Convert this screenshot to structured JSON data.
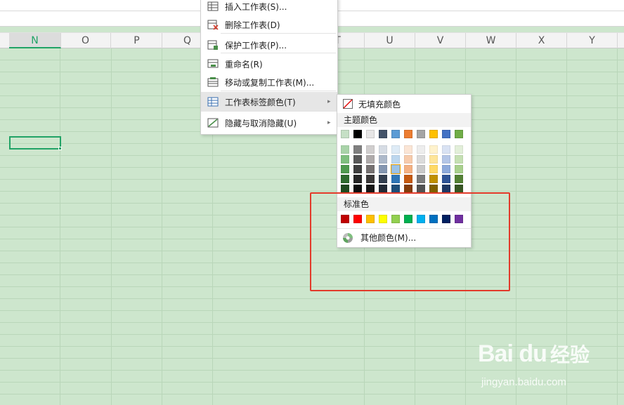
{
  "columns": [
    {
      "label": "N",
      "active": true
    },
    {
      "label": "O"
    },
    {
      "label": "P"
    },
    {
      "label": "Q"
    },
    {
      "label": "T"
    },
    {
      "label": "U"
    },
    {
      "label": "V"
    },
    {
      "label": "W"
    },
    {
      "label": "X"
    },
    {
      "label": "Y"
    }
  ],
  "context_menu": {
    "items": [
      {
        "label": "插入工作表(S)...",
        "icon": "insert-sheet-icon"
      },
      {
        "label": "删除工作表(D)",
        "icon": "delete-sheet-icon"
      },
      {
        "label": "保护工作表(P)...",
        "icon": "protect-sheet-icon"
      },
      {
        "label": "重命名(R)",
        "icon": "rename-icon"
      },
      {
        "label": "移动或复制工作表(M)...",
        "icon": "move-copy-sheet-icon"
      },
      {
        "label": "工作表标签颜色(T)",
        "icon": "tab-color-icon",
        "has_submenu": true,
        "hovered": true
      },
      {
        "label": "隐藏与取消隐藏(U)",
        "icon": "hide-unhide-icon",
        "has_submenu": true
      }
    ]
  },
  "color_menu": {
    "no_fill_label": "无填充颜色",
    "theme_label": "主题颜色",
    "standard_label": "标准色",
    "more_label": "其他颜色(M)...",
    "theme_colors": [
      "#c6e0c6",
      "#000000",
      "#e7e6e6",
      "#44546a",
      "#5b9bd5",
      "#ed7d31",
      "#a5a5a5",
      "#ffc000",
      "#4472c4",
      "#70ad47"
    ],
    "theme_shades": [
      [
        "#a9d3a9",
        "#7fbf7f",
        "#4f9a4f",
        "#2e6b2e",
        "#1e4a1e"
      ],
      [
        "#7f7f7f",
        "#595959",
        "#3f3f3f",
        "#262626",
        "#0d0d0d"
      ],
      [
        "#d0cece",
        "#afabab",
        "#757171",
        "#3a3838",
        "#171616"
      ],
      [
        "#d6dce4",
        "#adb9ca",
        "#8496b0",
        "#333f4f",
        "#222a35"
      ],
      [
        "#deebf6",
        "#bdd7ee",
        "#9dc3e6",
        "#2e75b5",
        "#1e4e79"
      ],
      [
        "#fbe5d5",
        "#f7cbac",
        "#f4b183",
        "#c55a11",
        "#833c0b"
      ],
      [
        "#ededed",
        "#dbdbdb",
        "#c9c9c9",
        "#7b7b7b",
        "#525252"
      ],
      [
        "#fff2cc",
        "#fee599",
        "#ffd965",
        "#bf9000",
        "#7f6000"
      ],
      [
        "#d9e2f3",
        "#b4c6e7",
        "#8eaadb",
        "#2f5496",
        "#1f3864"
      ],
      [
        "#e2efd9",
        "#c5e0b3",
        "#a8d08d",
        "#538135",
        "#375623"
      ]
    ],
    "standard_colors": [
      "#c00000",
      "#ff0000",
      "#ffc000",
      "#ffff00",
      "#92d050",
      "#00b050",
      "#00b0f0",
      "#0070c0",
      "#002060",
      "#7030a0"
    ]
  },
  "watermark": {
    "logo": "Bai du",
    "cn": "经验",
    "url": "jingyan.baidu.com"
  }
}
